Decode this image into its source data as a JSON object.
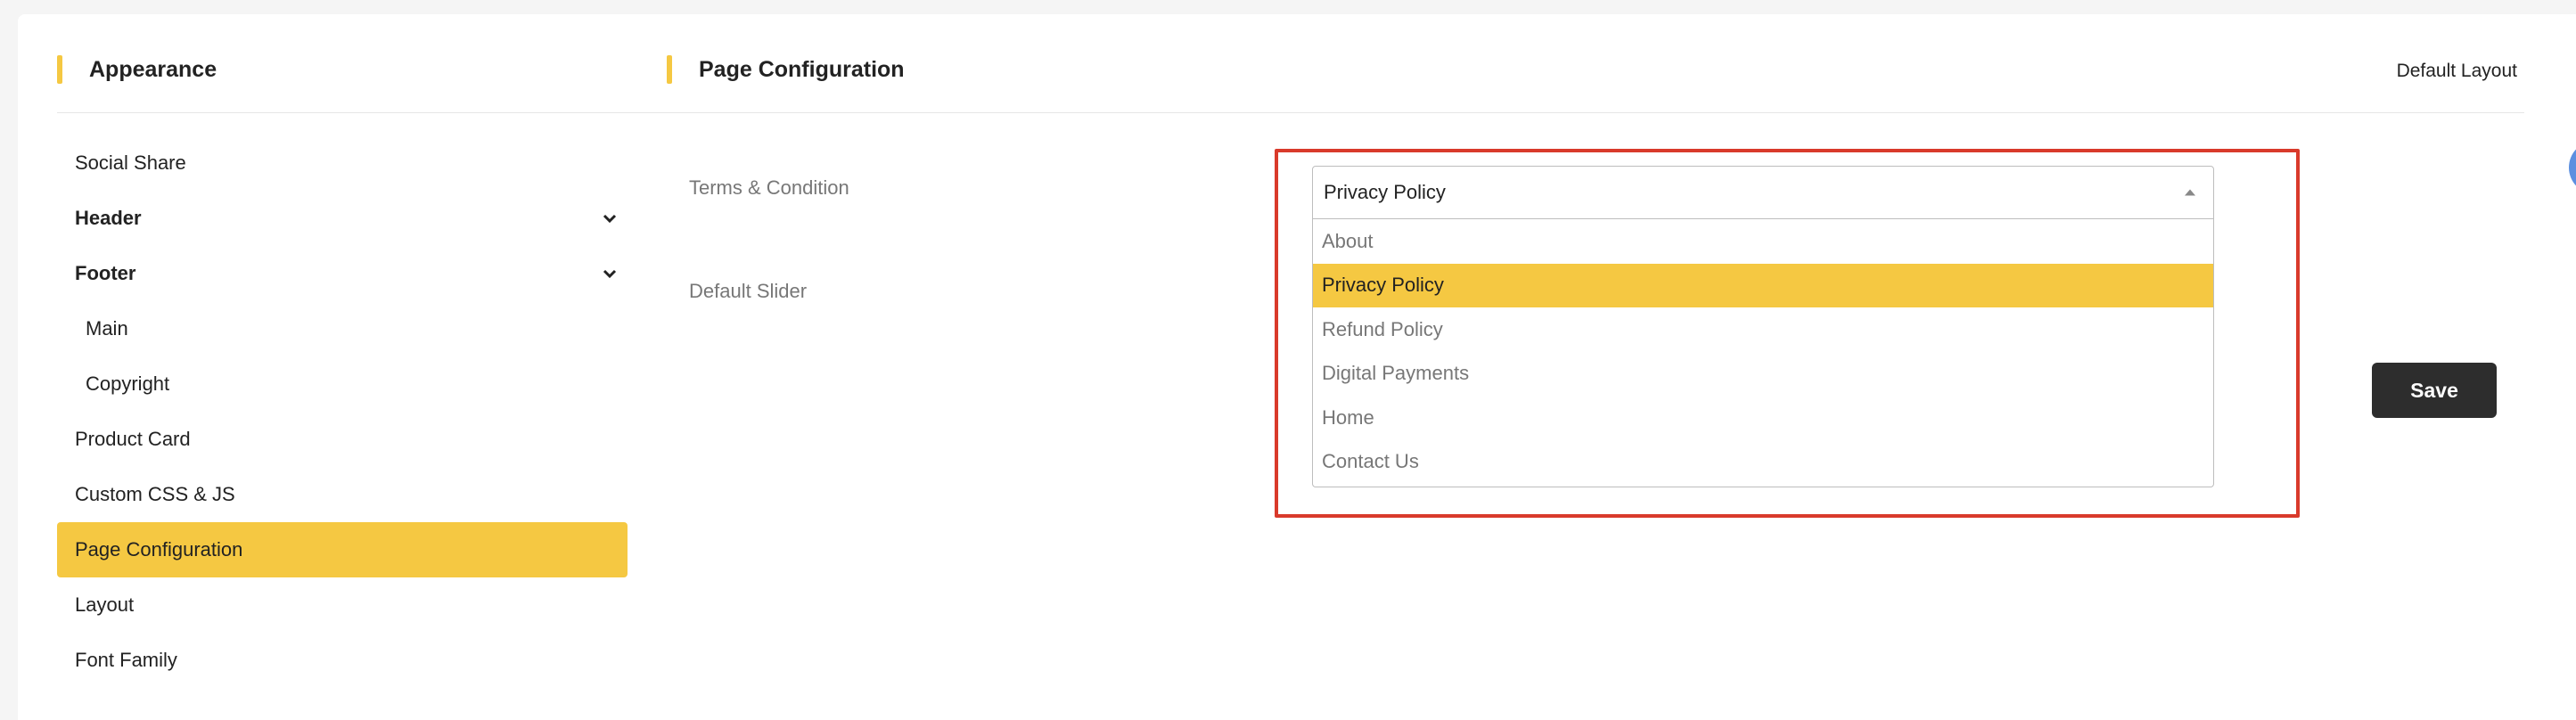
{
  "sidebar": {
    "title": "Appearance",
    "items": [
      {
        "label": "Social Share"
      },
      {
        "label": "Header"
      },
      {
        "label": "Footer"
      },
      {
        "label": "Main"
      },
      {
        "label": "Copyright"
      },
      {
        "label": "Product Card"
      },
      {
        "label": "Custom CSS & JS"
      },
      {
        "label": "Page Configuration"
      },
      {
        "label": "Layout"
      },
      {
        "label": "Font Family"
      }
    ]
  },
  "main": {
    "title": "Page Configuration",
    "default_layout_label": "Default Layout",
    "fields": {
      "terms_label": "Terms & Condition",
      "slider_label": "Default Slider"
    },
    "select": {
      "value": "Privacy Policy",
      "options": [
        {
          "label": "About"
        },
        {
          "label": "Privacy Policy"
        },
        {
          "label": "Refund Policy"
        },
        {
          "label": "Digital Payments"
        },
        {
          "label": "Home"
        },
        {
          "label": "Contact Us"
        }
      ]
    },
    "save_label": "Save"
  },
  "colors": {
    "accent": "#f5c842",
    "highlight_border": "#d93a2b",
    "save_button": "#2d2d2d"
  }
}
